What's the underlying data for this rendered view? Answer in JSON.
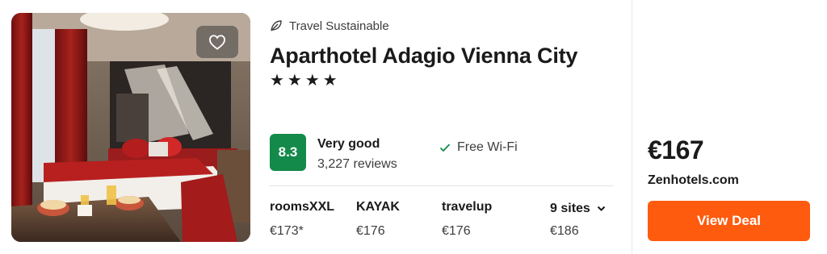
{
  "hotel": {
    "eco_label": "Travel Sustainable",
    "name": "Aparthotel Adagio Vienna City",
    "stars": "★★★★",
    "score": "8.3",
    "rating_label": "Very good",
    "reviews": "3,227 reviews",
    "amenity": "Free Wi-Fi"
  },
  "providers": [
    {
      "name": "roomsXXL",
      "price": "€173*"
    },
    {
      "name": "KAYAK",
      "price": "€176"
    },
    {
      "name": "travelup",
      "price": "€176"
    }
  ],
  "more_sites": {
    "label": "9 sites",
    "price": "€186"
  },
  "deal": {
    "price": "€167",
    "site": "Zenhotels.com",
    "button_label": "View Deal"
  },
  "colors": {
    "score_bg": "#138a4a",
    "deal_button": "#ff5b0f",
    "check_mark": "#138a4a"
  },
  "icons": {
    "favorite": "heart-icon",
    "eco": "leaf-icon",
    "amenity": "check-icon",
    "more": "chevron-down-icon"
  }
}
